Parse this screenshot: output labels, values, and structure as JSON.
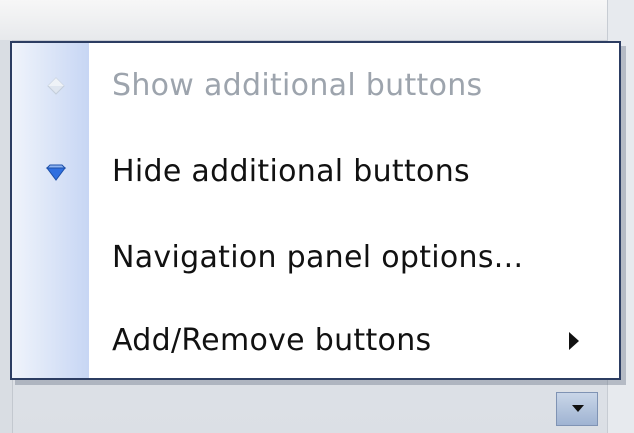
{
  "menu": {
    "items": [
      {
        "label": "Show additional buttons",
        "disabled": true,
        "icon": "diamond-up-icon"
      },
      {
        "label": "Hide additional buttons",
        "disabled": false,
        "icon": "diamond-down-icon"
      },
      {
        "label": "Navigation panel options...",
        "disabled": false,
        "icon": ""
      },
      {
        "label": "Add/Remove buttons",
        "disabled": false,
        "icon": "submenu-arrow-icon"
      }
    ]
  },
  "colors": {
    "menu_border": "#2c3d62",
    "gutter_light": "#f0f4fb",
    "gutter_dark": "#c7d6f4",
    "disabled_text": "#9da4ad",
    "icon_blue": "#2f6fe0"
  }
}
